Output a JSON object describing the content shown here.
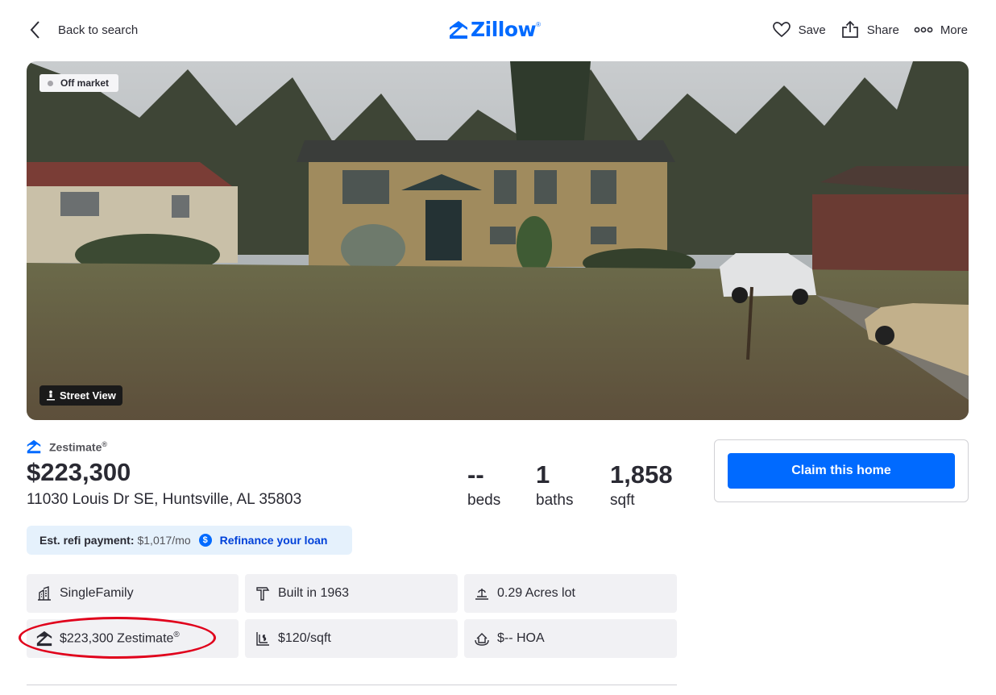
{
  "header": {
    "back_label": "Back to search",
    "logo_text": "Zillow",
    "logo_mark": "®",
    "actions": [
      {
        "label": "Save",
        "icon": "heart-icon"
      },
      {
        "label": "Share",
        "icon": "share-icon"
      },
      {
        "label": "More",
        "icon": "more-icon"
      }
    ]
  },
  "photo": {
    "status_badge": "Off market",
    "street_view_label": "Street View"
  },
  "summary": {
    "zestimate_label": "Zestimate",
    "zestimate_mark": "®",
    "price": "$223,300",
    "address": "11030 Louis Dr SE, Huntsville, AL 35803",
    "stats": [
      {
        "value": "--",
        "unit": "beds"
      },
      {
        "value": "1",
        "unit": "baths"
      },
      {
        "value": "1,858",
        "unit": "sqft"
      }
    ]
  },
  "refi": {
    "label": "Est. refi payment:",
    "value": "$1,017/mo",
    "link": "Refinance your loan"
  },
  "facts": [
    {
      "text": "SingleFamily",
      "icon": "building-icon"
    },
    {
      "text": "Built in 1963",
      "icon": "hammer-icon"
    },
    {
      "text": "0.29 Acres lot",
      "icon": "lot-icon"
    },
    {
      "text": "$223,300 Zestimate",
      "icon": "zestimate-icon"
    },
    {
      "text": "$120/sqft",
      "icon": "price-per-sqft-icon"
    },
    {
      "text": "$-- HOA",
      "icon": "hoa-icon"
    }
  ],
  "claim": {
    "button_label": "Claim this home"
  },
  "colors": {
    "brand": "#006aff",
    "annotation_circle": "#e0001b",
    "refi_bg": "#e5f1fc"
  }
}
